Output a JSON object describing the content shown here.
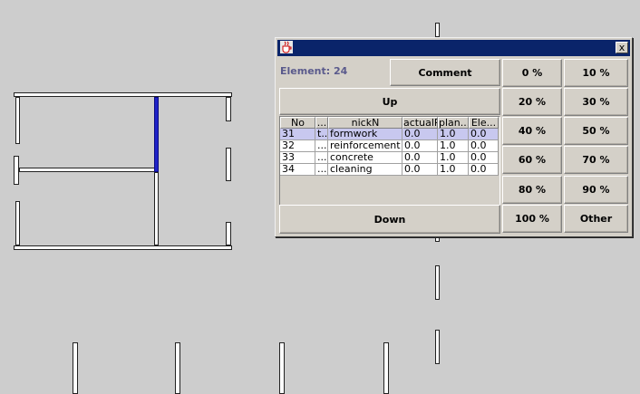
{
  "dialog": {
    "element_label": "Element: 24",
    "comment_label": "Comment",
    "up_label": "Up",
    "down_label": "Down",
    "close_label": "x"
  },
  "percent_buttons": [
    "0 %",
    "10 %",
    "20 %",
    "30 %",
    "40 %",
    "50 %",
    "60 %",
    "70 %",
    "80 %",
    "90 %",
    "100 %",
    "Other"
  ],
  "table": {
    "columns": [
      "No",
      "...",
      "nickN",
      "actualP",
      "plan...",
      "Ele..."
    ],
    "rows": [
      [
        "31",
        "t...",
        "formwork",
        "0.0",
        "1.0",
        "0.0"
      ],
      [
        "32",
        "...",
        "reinforcement",
        "0.0",
        "1.0",
        "0.0"
      ],
      [
        "33",
        "...",
        "concrete",
        "0.0",
        "1.0",
        "0.0"
      ],
      [
        "34",
        "...",
        "cleaning",
        "0.0",
        "1.0",
        "0.0"
      ]
    ],
    "selected_row": 0
  },
  "colors": {
    "background": "#cdcdcd",
    "titlebar": "#0a246a",
    "selected_wall": "#1e22c8",
    "selected_row": "#c8c8ef"
  }
}
